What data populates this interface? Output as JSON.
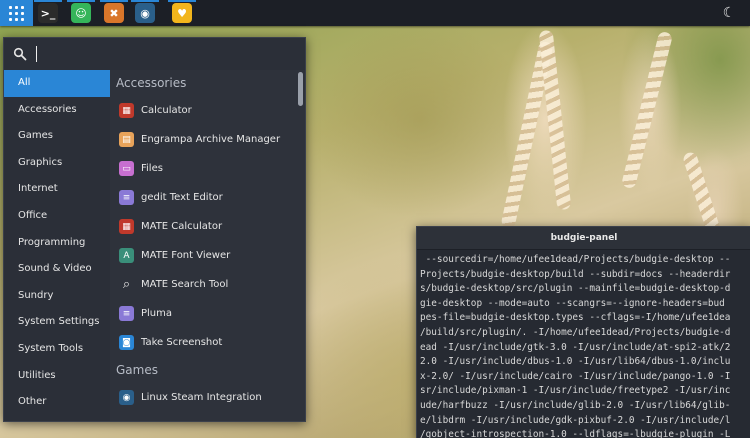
{
  "panel": {
    "tasks": [
      {
        "name": "terminal",
        "glyph": ">_",
        "color": "#2b2b2b"
      },
      {
        "name": "chat",
        "glyph": "☺",
        "color": "#35b55a"
      },
      {
        "name": "game",
        "glyph": "✖",
        "color": "#d9762a"
      },
      {
        "name": "steam",
        "glyph": "◉",
        "color": "#2a5f8a"
      },
      {
        "name": "emoji",
        "glyph": "♥",
        "color": "#f2b51c"
      }
    ],
    "night_icon": "☾"
  },
  "menu": {
    "search": {
      "value": "",
      "placeholder": ""
    },
    "categories": [
      "All",
      "Accessories",
      "Games",
      "Graphics",
      "Internet",
      "Office",
      "Programming",
      "Sound & Video",
      "Sundry",
      "System Settings",
      "System Tools",
      "Utilities",
      "Other"
    ],
    "active_category": "All",
    "sections": [
      {
        "title": "Accessories",
        "apps": [
          {
            "label": "Calculator",
            "icon": "calculator-icon",
            "color": "#c0392b"
          },
          {
            "label": "Engrampa Archive Manager",
            "icon": "archive-icon",
            "color": "#e8a35a"
          },
          {
            "label": "Files",
            "icon": "folder-icon",
            "color": "#c76fd0"
          },
          {
            "label": "gedit Text Editor",
            "icon": "text-editor-icon",
            "color": "#8a79d6"
          },
          {
            "label": "MATE Calculator",
            "icon": "calculator-icon",
            "color": "#c0392b"
          },
          {
            "label": "MATE Font Viewer",
            "icon": "font-viewer-icon",
            "color": "#3a8f7a"
          },
          {
            "label": "MATE Search Tool",
            "icon": "search-tool-icon",
            "color": "#2e323b"
          },
          {
            "label": "Pluma",
            "icon": "text-editor-icon",
            "color": "#8a79d6"
          },
          {
            "label": "Take Screenshot",
            "icon": "camera-icon",
            "color": "#2a86d6"
          }
        ]
      },
      {
        "title": "Games",
        "apps": [
          {
            "label": "Linux Steam Integration",
            "icon": "steam-icon",
            "color": "#2a5f8a"
          }
        ]
      }
    ]
  },
  "terminal": {
    "title": "budgie-panel",
    "lines": [
      " --sourcedir=/home/ufee1dead/Projects/budgie-desktop --",
      "Projects/budgie-desktop/build --subdir=docs --headerdir",
      "s/budgie-desktop/src/plugin --mainfile=budgie-desktop-d",
      "gie-desktop --mode=auto --scangrs=--ignore-headers=bud",
      "pes-file=budgie-desktop.types --cflags=-I/home/ufee1dea",
      "/build/src/plugin/. -I/home/ufee1dead/Projects/budgie-d",
      "ead -I/usr/include/gtk-3.0 -I/usr/include/at-spi2-atk/2",
      "2.0 -I/usr/include/dbus-1.0 -I/usr/lib64/dbus-1.0/inclu",
      "x-2.0/ -I/usr/include/cairo -I/usr/include/pango-1.0 -I",
      "sr/include/pixman-1 -I/usr/include/freetype2 -I/usr/inc",
      "ude/harfbuzz -I/usr/include/glib-2.0 -I/usr/lib64/glib-",
      "e/libdrm -I/usr/include/gdk-pixbuf-2.0 -I/usr/include/l",
      "/gobject-introspection-1.0 --ldflags=-lbudgie-plugin -L",
      "budgie-desktop/build/src/plugin -Wl,-rpath /home/ufee1d"
    ]
  }
}
